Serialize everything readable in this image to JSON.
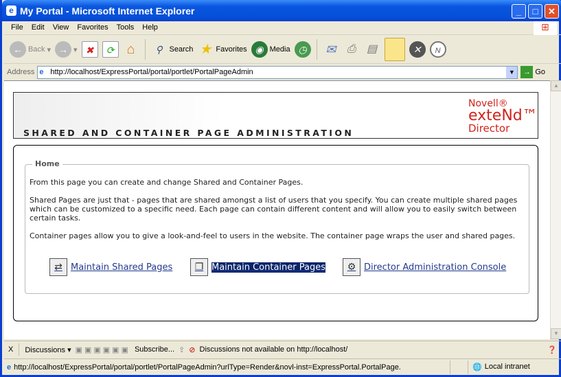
{
  "window": {
    "title": "My Portal - Microsoft Internet Explorer",
    "min": "_",
    "max": "□",
    "close": "✕"
  },
  "menu": [
    "File",
    "Edit",
    "View",
    "Favorites",
    "Tools",
    "Help"
  ],
  "toolbar": {
    "back": "Back",
    "search": "Search",
    "favorites": "Favorites",
    "media": "Media"
  },
  "address": {
    "label": "Address",
    "url": "http://localhost/ExpressPortal/portal/portlet/PortalPageAdmin",
    "go": "Go"
  },
  "header": {
    "title": "SHARED AND CONTAINER PAGE ADMINISTRATION",
    "logo": {
      "line1": "Novell®",
      "line2": "exteNd™",
      "line3": "Director"
    }
  },
  "home": {
    "legend": "Home",
    "p1": "From this page you can create and change Shared and Container Pages.",
    "p2": "Shared Pages are just that - pages that are shared amongst a list of users that you specify. You can create multiple shared pages which can be customized to a specific need. Each page can contain different content and will allow you to easily switch between certain tasks.",
    "p3": "Container pages allow you to give a look-and-feel to users in the website. The container page wraps the user and shared pages.",
    "links": [
      "Maintain Shared Pages",
      "Maintain Container Pages",
      "Director Administration Console"
    ]
  },
  "discussions": {
    "close": "X",
    "label": "Discussions ▾",
    "subscribe": "Subscribe...",
    "message": "Discussions not available on http://localhost/"
  },
  "status": {
    "url": "http://localhost/ExpressPortal/portal/portlet/PortalPageAdmin?urlType=Render&novl-inst=ExpressPortal.PortalPage.",
    "zone": "Local intranet"
  }
}
